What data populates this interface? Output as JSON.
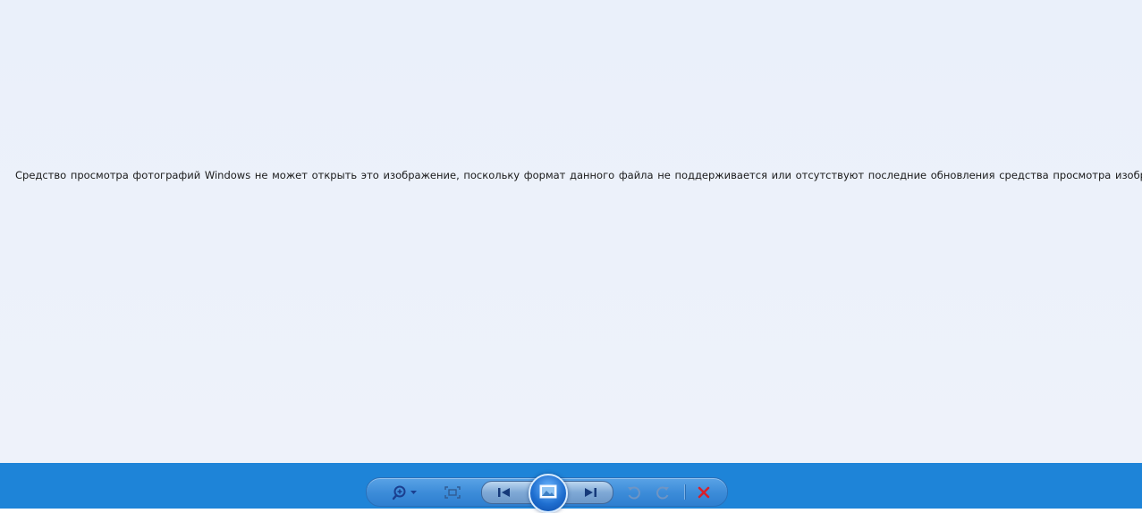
{
  "viewer": {
    "error_message": "Средство просмотра фотографий Windows не может открыть это изображение, поскольку формат данного файла не поддерживается или отсутствуют последние обновления средства просмотра изображений."
  },
  "toolbar": {
    "buttons": [
      {
        "name": "zoom",
        "icon": "magnifier-zoom-icon"
      },
      {
        "name": "actual-size",
        "icon": "fit-window-icon"
      },
      {
        "name": "previous",
        "icon": "previous-icon"
      },
      {
        "name": "slideshow",
        "icon": "slideshow-icon"
      },
      {
        "name": "next",
        "icon": "next-icon"
      },
      {
        "name": "rotate-left",
        "icon": "rotate-counterclockwise-icon"
      },
      {
        "name": "rotate-right",
        "icon": "rotate-clockwise-icon"
      },
      {
        "name": "delete",
        "icon": "delete-x-icon"
      }
    ]
  },
  "colors": {
    "viewer_background": "#eef2fa",
    "bottombar_background": "#1e84d8",
    "delete_red": "#d9202a"
  }
}
